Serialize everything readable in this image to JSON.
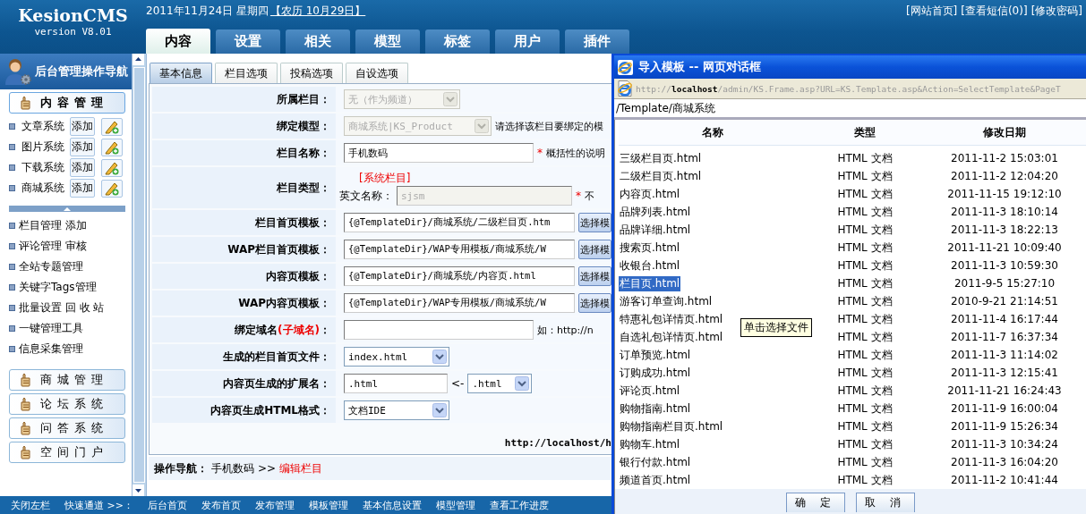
{
  "header": {
    "logo": "KesionCMS",
    "version": "version V8.01",
    "date": "2011年11月24日 星期四",
    "lunar": "【农历 10月29日】",
    "links": [
      "[网站首页]",
      "[查看短信(0)]",
      "[修改密码]"
    ],
    "tabs": [
      {
        "label": "内容",
        "selected": true
      },
      {
        "label": "设置",
        "selected": false
      },
      {
        "label": "相关",
        "selected": false
      },
      {
        "label": "模型",
        "selected": false
      },
      {
        "label": "标签",
        "selected": false
      },
      {
        "label": "用户",
        "selected": false
      },
      {
        "label": "插件",
        "selected": false
      }
    ]
  },
  "sidebar": {
    "title": "后台管理操作导航",
    "groups": [
      {
        "label": "内容管理",
        "expanded": true,
        "systems": [
          {
            "name": "文章系统",
            "add": "添加"
          },
          {
            "name": "图片系统",
            "add": "添加"
          },
          {
            "name": "下载系统",
            "add": "添加"
          },
          {
            "name": "商城系统",
            "add": "添加"
          }
        ],
        "links": [
          "栏目管理 添加",
          "评论管理 审核",
          "全站专题管理",
          "关键字Tags管理",
          "批量设置 回 收 站",
          "一键管理工具",
          "信息采集管理"
        ]
      },
      {
        "label": "商城管理",
        "expanded": false
      },
      {
        "label": "论坛系统",
        "expanded": false
      },
      {
        "label": "问答系统",
        "expanded": false
      },
      {
        "label": "空间门户",
        "expanded": false
      }
    ]
  },
  "form": {
    "tabs": [
      {
        "label": "基本信息",
        "selected": true
      },
      {
        "label": "栏目选项",
        "selected": false
      },
      {
        "label": "投稿选项",
        "selected": false
      },
      {
        "label": "自设选项",
        "selected": false
      }
    ],
    "rows": [
      {
        "kind": "select",
        "label": "所属栏目：",
        "value": "无（作为频道）",
        "disabled": true
      },
      {
        "kind": "select",
        "label": "绑定模型：",
        "value": "商城系统|KS_Product",
        "disabled": true,
        "hint": "请选择该栏目要绑定的模"
      },
      {
        "kind": "text",
        "label": "栏目名称：",
        "value": "手机数码",
        "required": true,
        "required_mark": "*",
        "hint": "概括性的说明"
      },
      {
        "kind": "type",
        "label": "栏目类型：",
        "type_tag": "[系统栏目]",
        "sub_label": "英文名称：",
        "value": "sjsm",
        "disabled": true,
        "required": true,
        "required_mark": "*",
        "hint": "不"
      },
      {
        "kind": "template",
        "label": "栏目首页模板：",
        "value": "{@TemplateDir}/商城系统/二级栏目页.htm",
        "button": "选择模"
      },
      {
        "kind": "template",
        "label": "WAP栏目首页模板：",
        "value": "{@TemplateDir}/WAP专用模板/商城系统/W",
        "button": "选择模"
      },
      {
        "kind": "template",
        "label": "内容页模板：",
        "value": "{@TemplateDir}/商城系统/内容页.html",
        "button": "选择模"
      },
      {
        "kind": "template",
        "label": "WAP内容页模板：",
        "value": "{@TemplateDir}/WAP专用模板/商城系统/W",
        "button": "选择模"
      },
      {
        "kind": "text",
        "label": "绑定域名",
        "label_note": "(子域名)",
        "label_end": "：",
        "hint": "如：http://n"
      },
      {
        "kind": "select",
        "label": "生成的栏目首页文件：",
        "value": "index.html",
        "disabled": false
      },
      {
        "kind": "ext",
        "label": "内容页生成的扩展名：",
        "value": ".html",
        "arrow": "<-",
        "choice": ".html"
      },
      {
        "kind": "select",
        "label": "内容页生成HTML格式：",
        "value": "文档IDE",
        "disabled": false
      }
    ],
    "url": "http://localhost/h",
    "nav": {
      "label": "操作导航：",
      "path": "手机数码",
      "sep": ">>",
      "current": "编辑栏目"
    }
  },
  "bottom_bar": [
    "关闭左栏",
    "快速通道 >>：",
    "后台首页",
    "发布首页",
    "发布管理",
    "模板管理",
    "基本信息设置",
    "模型管理",
    "查看工作进度"
  ],
  "dialog": {
    "title": "导入模板 -- 网页对话框",
    "address": "http://**localhost**/admin/KS.Frame.asp?URL=KS.Template.asp&Action=SelectTemplate&PageT",
    "path": "/Template/商城系统",
    "columns": [
      "名称",
      "类型",
      "修改日期"
    ],
    "rows": [
      {
        "name": "三级栏目页.html",
        "type": "HTML 文档",
        "date": "2011-11-2 15:03:01",
        "selected": false
      },
      {
        "name": "二级栏目页.html",
        "type": "HTML 文档",
        "date": "2011-11-2 12:04:20",
        "selected": false
      },
      {
        "name": "内容页.html",
        "type": "HTML 文档",
        "date": "2011-11-15 19:12:10",
        "selected": false
      },
      {
        "name": "品牌列表.html",
        "type": "HTML 文档",
        "date": "2011-11-3 18:10:14",
        "selected": false
      },
      {
        "name": "品牌详细.html",
        "type": "HTML 文档",
        "date": "2011-11-3 18:22:13",
        "selected": false
      },
      {
        "name": "搜索页.html",
        "type": "HTML 文档",
        "date": "2011-11-21 10:09:40",
        "selected": false
      },
      {
        "name": "收银台.html",
        "type": "HTML 文档",
        "date": "2011-11-3 10:59:30",
        "selected": false
      },
      {
        "name": "栏目页.html",
        "type": "HTML 文档",
        "date": "2011-9-5 15:27:10",
        "selected": true
      },
      {
        "name": "游客订单查询.html",
        "type": "HTML 文档",
        "date": "2010-9-21 21:14:51",
        "selected": false
      },
      {
        "name": "特惠礼包详情页.html",
        "type": "HTML 文档",
        "date": "2011-11-4 16:17:44",
        "selected": false
      },
      {
        "name": "自选礼包详情页.html",
        "type": "HTML 文档",
        "date": "2011-11-7 16:37:34",
        "selected": false
      },
      {
        "name": "订单预览.html",
        "type": "HTML 文档",
        "date": "2011-11-3 11:14:02",
        "selected": false
      },
      {
        "name": "订购成功.html",
        "type": "HTML 文档",
        "date": "2011-11-3 12:15:41",
        "selected": false
      },
      {
        "name": "评论页.html",
        "type": "HTML 文档",
        "date": "2011-11-21 16:24:43",
        "selected": false
      },
      {
        "name": "购物指南.html",
        "type": "HTML 文档",
        "date": "2011-11-9 16:00:04",
        "selected": false
      },
      {
        "name": "购物指南栏目页.html",
        "type": "HTML 文档",
        "date": "2011-11-9 15:26:34",
        "selected": false
      },
      {
        "name": "购物车.html",
        "type": "HTML 文档",
        "date": "2011-11-3 10:34:24",
        "selected": false
      },
      {
        "name": "银行付款.html",
        "type": "HTML 文档",
        "date": "2011-11-3 16:04:20",
        "selected": false
      },
      {
        "name": "频道首页.html",
        "type": "HTML 文档",
        "date": "2011-11-2 10:41:44",
        "selected": false
      }
    ],
    "tooltip": "单击选择文件",
    "buttons": [
      "确 定",
      "取 消"
    ]
  }
}
